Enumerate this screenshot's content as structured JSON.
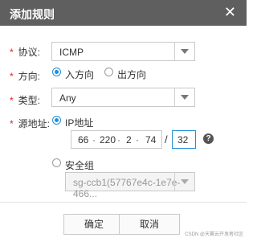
{
  "dialog": {
    "title": "添加规则",
    "close_glyph": "✕"
  },
  "protocol": {
    "label": "协议:",
    "value": "ICMP"
  },
  "direction": {
    "label": "方向:",
    "options": [
      "入方向",
      "出方向"
    ],
    "selected": "入方向"
  },
  "type": {
    "label": "类型:",
    "value": "Any"
  },
  "source": {
    "label": "源地址:",
    "ip_option_label": "IP地址",
    "ip_octets": [
      "66",
      "220",
      "2",
      "74"
    ],
    "mask": "32",
    "security_group_label": "安全组",
    "security_group_value": "sg-ccb1(57767e4c-1e7e-466..."
  },
  "footer": {
    "confirm_label": "确定",
    "cancel_label": "取消"
  },
  "watermark": "CSDN @天翼云开发者社区",
  "colors": {
    "accent": "#1f8fd8",
    "title_bar": "#5f5f5f",
    "required": "#e02020"
  }
}
